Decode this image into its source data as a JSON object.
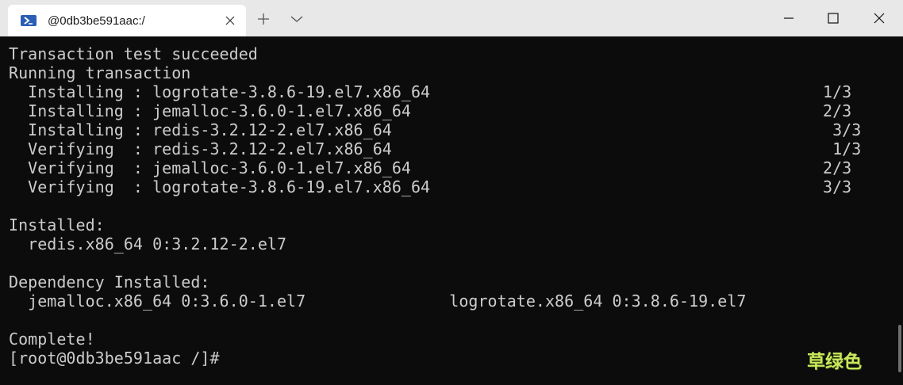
{
  "window": {
    "tab": {
      "title": "@0db3be591aac:/",
      "icon": "powershell-icon"
    },
    "controls": {
      "new_tab_icon": "plus-icon",
      "dropdown_icon": "chevron-down-icon",
      "minimize_icon": "minimize-icon",
      "maximize_icon": "maximize-icon",
      "close_icon": "close-icon"
    }
  },
  "terminal": {
    "lines": [
      "Transaction test succeeded",
      "Running transaction",
      "  Installing : logrotate-3.8.6-19.el7.x86_64                                         1/3",
      "  Installing : jemalloc-3.6.0-1.el7.x86_64                                           2/3",
      "  Installing : redis-3.2.12-2.el7.x86_64                                              3/3",
      "  Verifying  : redis-3.2.12-2.el7.x86_64                                              1/3",
      "  Verifying  : jemalloc-3.6.0-1.el7.x86_64                                           2/3",
      "  Verifying  : logrotate-3.8.6-19.el7.x86_64                                         3/3",
      "",
      "Installed:",
      "  redis.x86_64 0:3.2.12-2.el7",
      "",
      "Dependency Installed:",
      "  jemalloc.x86_64 0:3.6.0-1.el7               logrotate.x86_64 0:3.8.6-19.el7",
      "",
      "Complete!",
      "[root@0db3be591aac /]#"
    ],
    "colors": {
      "background": "#0c0c0c",
      "foreground": "#cccccc"
    }
  },
  "watermark": "草绿色"
}
